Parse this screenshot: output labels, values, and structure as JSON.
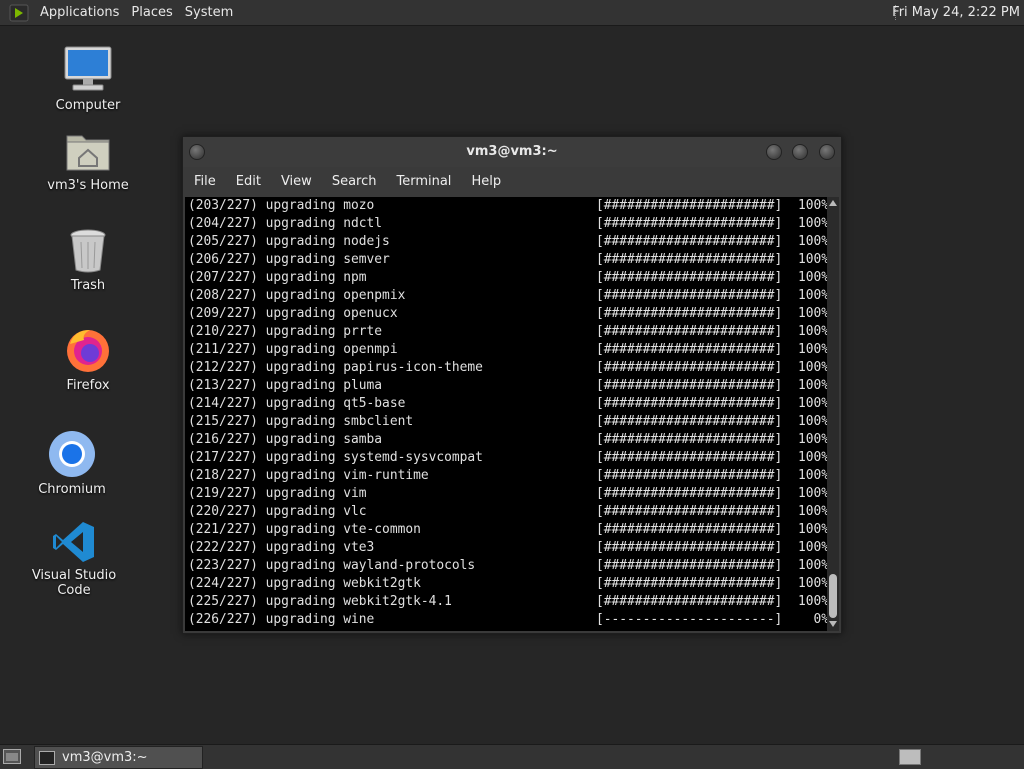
{
  "top_panel": {
    "menus": [
      "Applications",
      "Places",
      "System"
    ],
    "clock": "Fri May 24,  2:22 PM"
  },
  "desktop_icons": [
    {
      "label": "Computer",
      "icon": "computer-icon"
    },
    {
      "label": "vm3's Home",
      "icon": "home-folder-icon"
    },
    {
      "label": "Trash",
      "icon": "trash-icon"
    },
    {
      "label": "Firefox",
      "icon": "firefox-icon"
    },
    {
      "label": "Chromium",
      "icon": "chromium-icon"
    },
    {
      "label": "Visual Studio Code",
      "icon": "vscode-icon"
    }
  ],
  "terminal": {
    "title": "vm3@vm3:~",
    "menu": [
      "File",
      "Edit",
      "View",
      "Search",
      "Terminal",
      "Help"
    ],
    "lines": [
      {
        "count": "(203/227)",
        "action": "upgrading",
        "pkg": "mozo",
        "bar": "[######################]",
        "pct": "100%"
      },
      {
        "count": "(204/227)",
        "action": "upgrading",
        "pkg": "ndctl",
        "bar": "[######################]",
        "pct": "100%"
      },
      {
        "count": "(205/227)",
        "action": "upgrading",
        "pkg": "nodejs",
        "bar": "[######################]",
        "pct": "100%"
      },
      {
        "count": "(206/227)",
        "action": "upgrading",
        "pkg": "semver",
        "bar": "[######################]",
        "pct": "100%"
      },
      {
        "count": "(207/227)",
        "action": "upgrading",
        "pkg": "npm",
        "bar": "[######################]",
        "pct": "100%"
      },
      {
        "count": "(208/227)",
        "action": "upgrading",
        "pkg": "openpmix",
        "bar": "[######################]",
        "pct": "100%"
      },
      {
        "count": "(209/227)",
        "action": "upgrading",
        "pkg": "openucx",
        "bar": "[######################]",
        "pct": "100%"
      },
      {
        "count": "(210/227)",
        "action": "upgrading",
        "pkg": "prrte",
        "bar": "[######################]",
        "pct": "100%"
      },
      {
        "count": "(211/227)",
        "action": "upgrading",
        "pkg": "openmpi",
        "bar": "[######################]",
        "pct": "100%"
      },
      {
        "count": "(212/227)",
        "action": "upgrading",
        "pkg": "papirus-icon-theme",
        "bar": "[######################]",
        "pct": "100%"
      },
      {
        "count": "(213/227)",
        "action": "upgrading",
        "pkg": "pluma",
        "bar": "[######################]",
        "pct": "100%"
      },
      {
        "count": "(214/227)",
        "action": "upgrading",
        "pkg": "qt5-base",
        "bar": "[######################]",
        "pct": "100%"
      },
      {
        "count": "(215/227)",
        "action": "upgrading",
        "pkg": "smbclient",
        "bar": "[######################]",
        "pct": "100%"
      },
      {
        "count": "(216/227)",
        "action": "upgrading",
        "pkg": "samba",
        "bar": "[######################]",
        "pct": "100%"
      },
      {
        "count": "(217/227)",
        "action": "upgrading",
        "pkg": "systemd-sysvcompat",
        "bar": "[######################]",
        "pct": "100%"
      },
      {
        "count": "(218/227)",
        "action": "upgrading",
        "pkg": "vim-runtime",
        "bar": "[######################]",
        "pct": "100%"
      },
      {
        "count": "(219/227)",
        "action": "upgrading",
        "pkg": "vim",
        "bar": "[######################]",
        "pct": "100%"
      },
      {
        "count": "(220/227)",
        "action": "upgrading",
        "pkg": "vlc",
        "bar": "[######################]",
        "pct": "100%"
      },
      {
        "count": "(221/227)",
        "action": "upgrading",
        "pkg": "vte-common",
        "bar": "[######################]",
        "pct": "100%"
      },
      {
        "count": "(222/227)",
        "action": "upgrading",
        "pkg": "vte3",
        "bar": "[######################]",
        "pct": "100%"
      },
      {
        "count": "(223/227)",
        "action": "upgrading",
        "pkg": "wayland-protocols",
        "bar": "[######################]",
        "pct": "100%"
      },
      {
        "count": "(224/227)",
        "action": "upgrading",
        "pkg": "webkit2gtk",
        "bar": "[######################]",
        "pct": "100%"
      },
      {
        "count": "(225/227)",
        "action": "upgrading",
        "pkg": "webkit2gtk-4.1",
        "bar": "[######################]",
        "pct": "100%"
      },
      {
        "count": "(226/227)",
        "action": "upgrading",
        "pkg": "wine",
        "bar": "[----------------------]",
        "pct": "0%"
      }
    ]
  },
  "taskbar": {
    "tasks": [
      {
        "label": "vm3@vm3:~"
      }
    ]
  }
}
